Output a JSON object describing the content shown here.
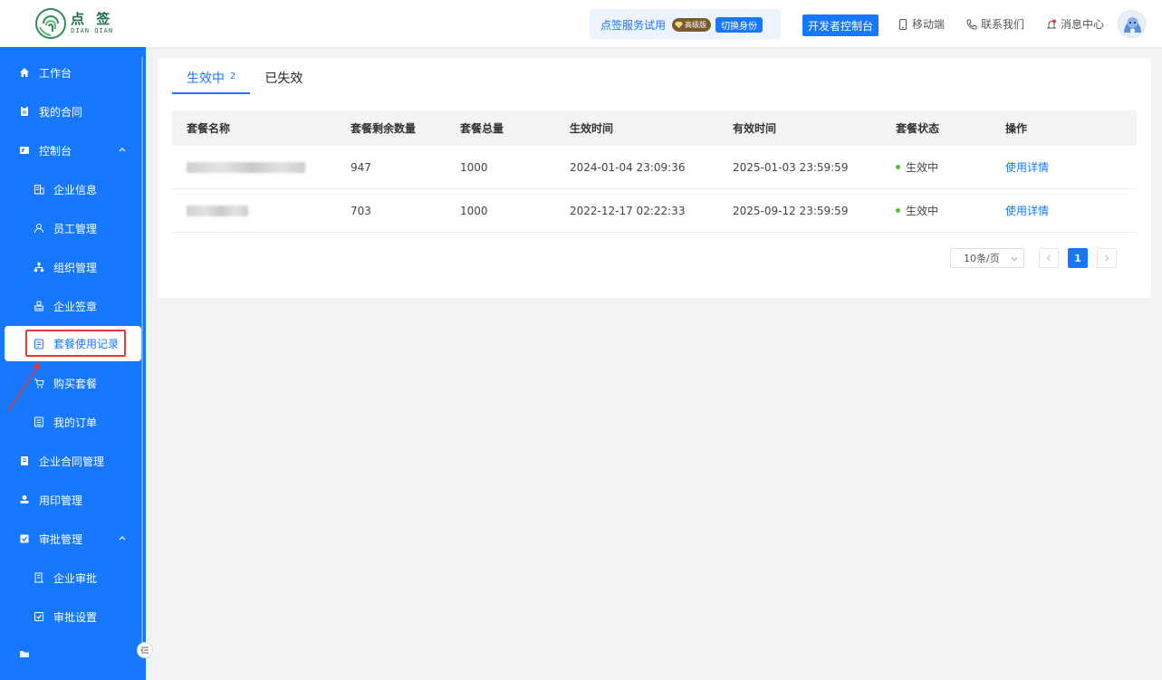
{
  "brand": {
    "name_cn": "点 签",
    "name_en": "DIAN QIAN",
    "accent": "#1677ff"
  },
  "header": {
    "trial_text": "点签服务试用",
    "badge_label": "高级版",
    "switch_label": "切换身份",
    "dev_console": "开发者控制台",
    "mobile": "移动端",
    "contact": "联系我们",
    "messages": "消息中心"
  },
  "sidebar": {
    "items": [
      {
        "label": "工作台",
        "icon": "home-icon"
      },
      {
        "label": "我的合同",
        "icon": "contract-icon"
      },
      {
        "label": "控制台",
        "icon": "console-icon"
      },
      {
        "label": "企业信息",
        "icon": "building-icon"
      },
      {
        "label": "员工管理",
        "icon": "user-icon"
      },
      {
        "label": "组织管理",
        "icon": "org-icon"
      },
      {
        "label": "企业签章",
        "icon": "stamp-icon"
      },
      {
        "label": "套餐使用记录",
        "icon": "record-icon"
      },
      {
        "label": "购买套餐",
        "icon": "cart-icon"
      },
      {
        "label": "我的订单",
        "icon": "order-icon"
      },
      {
        "label": "企业合同管理",
        "icon": "file-icon"
      },
      {
        "label": "用印管理",
        "icon": "seal-icon"
      },
      {
        "label": "审批管理",
        "icon": "approval-icon"
      },
      {
        "label": "企业审批",
        "icon": "enterprise-approval-icon"
      },
      {
        "label": "审批设置",
        "icon": "checkbox-icon"
      }
    ]
  },
  "tabs": {
    "active_label": "生效中",
    "active_count": "2",
    "inactive_label": "已失效"
  },
  "table": {
    "headers": [
      "套餐名称",
      "套餐剩余数量",
      "套餐总量",
      "生效时间",
      "有效时间",
      "套餐状态",
      "操作"
    ],
    "rows": [
      {
        "remaining": "947",
        "total": "1000",
        "start": "2024-01-04 23:09:36",
        "valid": "2025-01-03 23:59:59",
        "status": "生效中",
        "action": "使用详情"
      },
      {
        "remaining": "703",
        "total": "1000",
        "start": "2022-12-17 02:22:33",
        "valid": "2025-09-12 23:59:59",
        "status": "生效中",
        "action": "使用详情"
      }
    ]
  },
  "pagination": {
    "page_size": "10条/页",
    "current_page": "1"
  }
}
